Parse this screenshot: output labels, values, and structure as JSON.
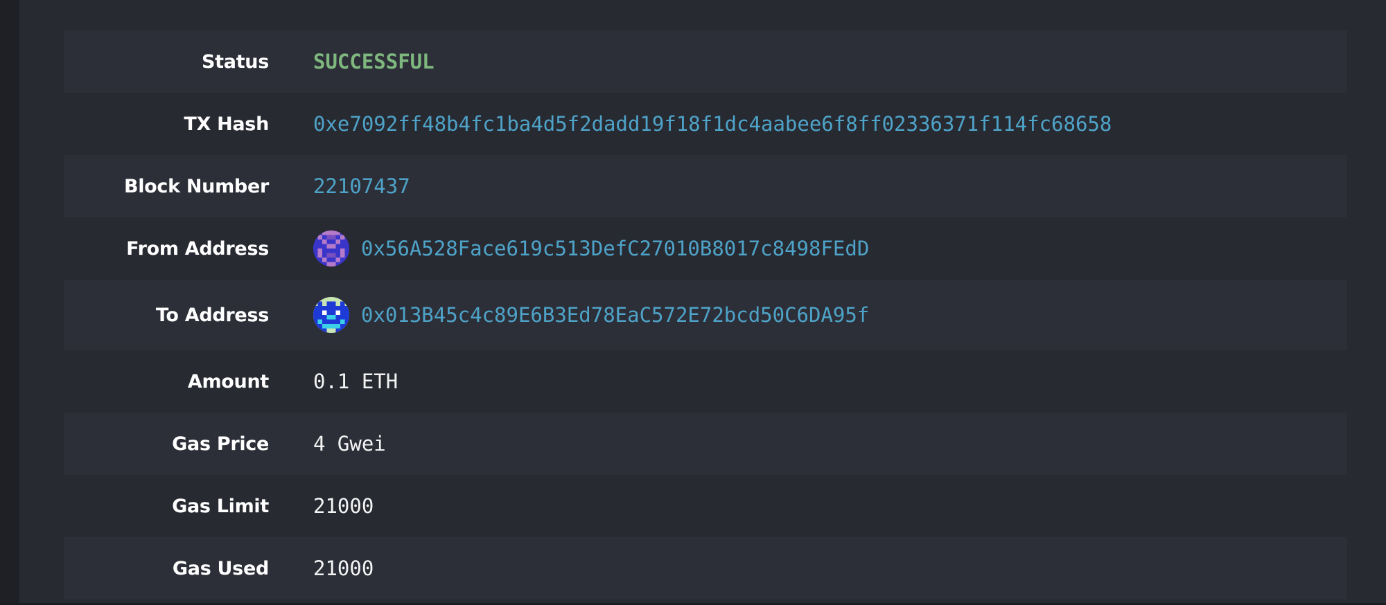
{
  "transaction": {
    "status": {
      "label": "Status",
      "value": "SUCCESSFUL"
    },
    "tx_hash": {
      "label": "TX Hash",
      "value": "0xe7092ff48b4fc1ba4d5f2dadd19f18f1dc4aabee6f8ff02336371f114fc68658"
    },
    "block_number": {
      "label": "Block Number",
      "value": "22107437"
    },
    "from_address": {
      "label": "From Address",
      "value": "0x56A528Face619c513DefC27010B8017c8498FEdD",
      "avatar_icon": "identicon-purple"
    },
    "to_address": {
      "label": "To Address",
      "value": "0x013B45c4c89E6B3Ed78EaC572E72bcd50C6DA95f",
      "avatar_icon": "identicon-blue"
    },
    "amount": {
      "label": "Amount",
      "value": "0.1 ETH"
    },
    "gas_price": {
      "label": "Gas Price",
      "value": "4 Gwei"
    },
    "gas_limit": {
      "label": "Gas Limit",
      "value": "21000"
    },
    "gas_used": {
      "label": "Gas Used",
      "value": "21000"
    }
  },
  "colors": {
    "background": "#282a32",
    "row_shaded": "#2d2f38",
    "success": "#7fb87f",
    "link": "#4ea3c8",
    "text": "#ffffff"
  }
}
